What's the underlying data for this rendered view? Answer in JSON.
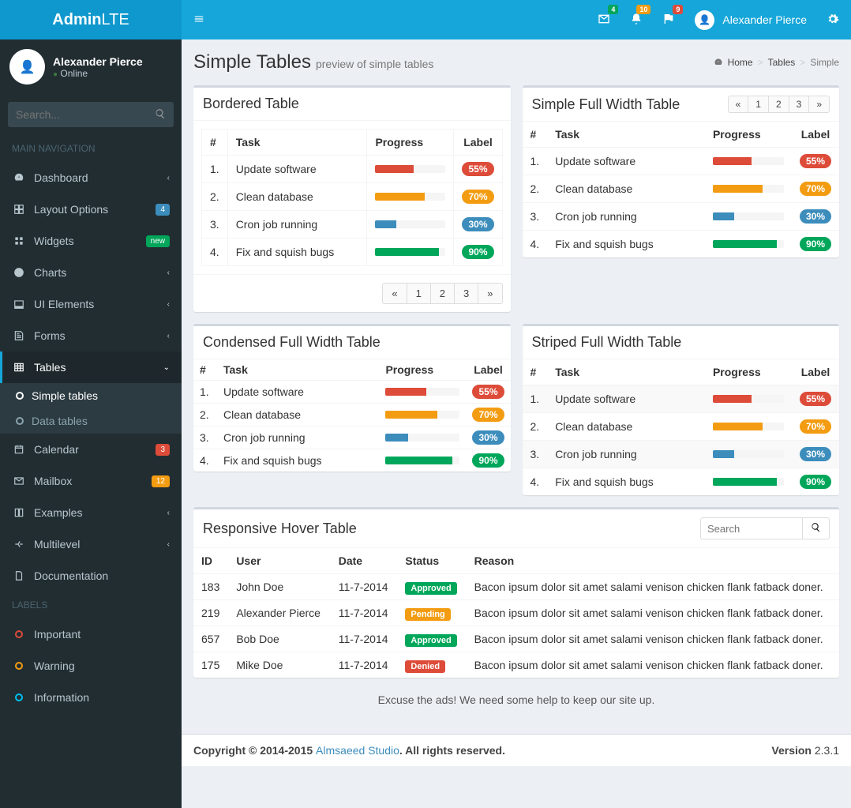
{
  "logo": {
    "bold": "Admin",
    "light": "LTE"
  },
  "header": {
    "notifications": {
      "mail": "4",
      "bell": "10",
      "flag": "9"
    },
    "user_name": "Alexander Pierce"
  },
  "sidebar": {
    "user": {
      "name": "Alexander Pierce",
      "status": "Online"
    },
    "search_placeholder": "Search...",
    "section_main": "MAIN NAVIGATION",
    "section_labels": "LABELS",
    "items": [
      {
        "label": "Dashboard"
      },
      {
        "label": "Layout Options",
        "badge": "4"
      },
      {
        "label": "Widgets",
        "badge": "new"
      },
      {
        "label": "Charts"
      },
      {
        "label": "UI Elements"
      },
      {
        "label": "Forms"
      },
      {
        "label": "Tables"
      },
      {
        "label": "Calendar",
        "badge": "3"
      },
      {
        "label": "Mailbox",
        "badge": "12"
      },
      {
        "label": "Examples"
      },
      {
        "label": "Multilevel"
      },
      {
        "label": "Documentation"
      }
    ],
    "submenu": [
      {
        "label": "Simple tables"
      },
      {
        "label": "Data tables"
      }
    ],
    "labels": [
      {
        "label": "Important"
      },
      {
        "label": "Warning"
      },
      {
        "label": "Information"
      }
    ]
  },
  "page": {
    "title": "Simple Tables",
    "subtitle": "preview of simple tables",
    "breadcrumb": {
      "home": "Home",
      "parent": "Tables",
      "current": "Simple"
    }
  },
  "tables": {
    "headers": {
      "num": "#",
      "task": "Task",
      "progress": "Progress",
      "label": "Label"
    },
    "bordered_title": "Bordered Table",
    "simple_full_title": "Simple Full Width Table",
    "condensed_title": "Condensed Full Width Table",
    "striped_title": "Striped Full Width Table",
    "rows": [
      {
        "num": "1.",
        "task": "Update software",
        "progress": 55,
        "color": "red"
      },
      {
        "num": "2.",
        "task": "Clean database",
        "progress": 70,
        "color": "yellow"
      },
      {
        "num": "3.",
        "task": "Cron job running",
        "progress": 30,
        "color": "blue"
      },
      {
        "num": "4.",
        "task": "Fix and squish bugs",
        "progress": 90,
        "color": "green"
      }
    ],
    "pagination": [
      "«",
      "1",
      "2",
      "3",
      "»"
    ]
  },
  "hover_table": {
    "title": "Responsive Hover Table",
    "search_placeholder": "Search",
    "headers": {
      "id": "ID",
      "user": "User",
      "date": "Date",
      "status": "Status",
      "reason": "Reason"
    },
    "rows": [
      {
        "id": "183",
        "user": "John Doe",
        "date": "11-7-2014",
        "status": "Approved",
        "status_class": "st-approved",
        "reason": "Bacon ipsum dolor sit amet salami venison chicken flank fatback doner."
      },
      {
        "id": "219",
        "user": "Alexander Pierce",
        "date": "11-7-2014",
        "status": "Pending",
        "status_class": "st-pending",
        "reason": "Bacon ipsum dolor sit amet salami venison chicken flank fatback doner."
      },
      {
        "id": "657",
        "user": "Bob Doe",
        "date": "11-7-2014",
        "status": "Approved",
        "status_class": "st-approved",
        "reason": "Bacon ipsum dolor sit amet salami venison chicken flank fatback doner."
      },
      {
        "id": "175",
        "user": "Mike Doe",
        "date": "11-7-2014",
        "status": "Denied",
        "status_class": "st-denied",
        "reason": "Bacon ipsum dolor sit amet salami venison chicken flank fatback doner."
      }
    ]
  },
  "ad_text": "Excuse the ads! We need some help to keep our site up.",
  "footer": {
    "copyright": "Copyright © 2014-2015 ",
    "studio": "Almsaeed Studio",
    "rights": ". All rights reserved.",
    "version_label": "Version ",
    "version": "2.3.1"
  }
}
